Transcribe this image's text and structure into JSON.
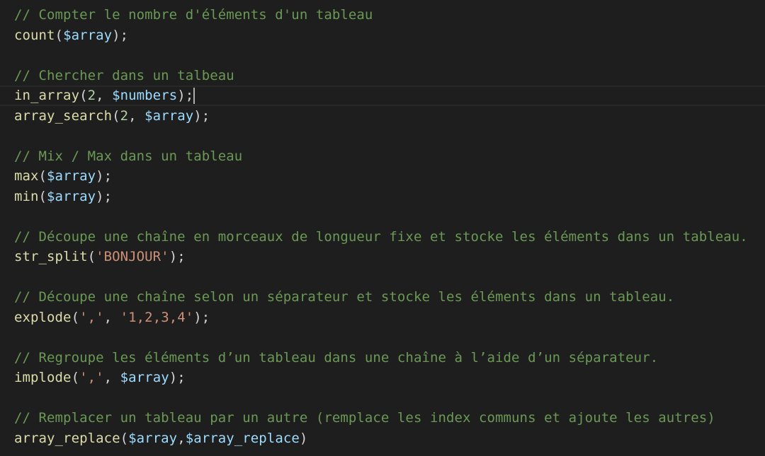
{
  "lines": [
    {
      "type": "comment",
      "text": "// Compter le nombre d'éléments d'un tableau"
    },
    {
      "type": "code",
      "tokens": [
        {
          "k": "fn",
          "t": "count"
        },
        {
          "k": "pun",
          "t": "("
        },
        {
          "k": "var",
          "t": "$array"
        },
        {
          "k": "pun",
          "t": ");"
        }
      ]
    },
    {
      "type": "blank"
    },
    {
      "type": "comment",
      "text": "// Chercher dans un talbeau"
    },
    {
      "type": "code",
      "current": true,
      "tokens": [
        {
          "k": "fn",
          "t": "in_array"
        },
        {
          "k": "pun",
          "t": "("
        },
        {
          "k": "num",
          "t": "2"
        },
        {
          "k": "pun",
          "t": ", "
        },
        {
          "k": "var",
          "t": "$numbers"
        },
        {
          "k": "pun",
          "t": ");"
        }
      ]
    },
    {
      "type": "code",
      "tokens": [
        {
          "k": "fn",
          "t": "array_search"
        },
        {
          "k": "pun",
          "t": "("
        },
        {
          "k": "num",
          "t": "2"
        },
        {
          "k": "pun",
          "t": ", "
        },
        {
          "k": "var",
          "t": "$array"
        },
        {
          "k": "pun",
          "t": ");"
        }
      ]
    },
    {
      "type": "blank"
    },
    {
      "type": "comment",
      "text": "// Mix / Max dans un tableau"
    },
    {
      "type": "code",
      "tokens": [
        {
          "k": "fn",
          "t": "max"
        },
        {
          "k": "pun",
          "t": "("
        },
        {
          "k": "var",
          "t": "$array"
        },
        {
          "k": "pun",
          "t": ");"
        }
      ]
    },
    {
      "type": "code",
      "tokens": [
        {
          "k": "fn",
          "t": "min"
        },
        {
          "k": "pun",
          "t": "("
        },
        {
          "k": "var",
          "t": "$array"
        },
        {
          "k": "pun",
          "t": ");"
        }
      ]
    },
    {
      "type": "blank"
    },
    {
      "type": "comment",
      "text": "// Découpe une chaîne en morceaux de longueur fixe et stocke les éléments dans un tableau."
    },
    {
      "type": "code",
      "tokens": [
        {
          "k": "fn",
          "t": "str_split"
        },
        {
          "k": "pun",
          "t": "("
        },
        {
          "k": "str",
          "t": "'BONJOUR'"
        },
        {
          "k": "pun",
          "t": ");"
        }
      ]
    },
    {
      "type": "blank"
    },
    {
      "type": "comment",
      "text": "// Découpe une chaîne selon un séparateur et stocke les éléments dans un tableau."
    },
    {
      "type": "code",
      "tokens": [
        {
          "k": "fn",
          "t": "explode"
        },
        {
          "k": "pun",
          "t": "("
        },
        {
          "k": "str",
          "t": "','"
        },
        {
          "k": "pun",
          "t": ", "
        },
        {
          "k": "str",
          "t": "'1,2,3,4'"
        },
        {
          "k": "pun",
          "t": ");"
        }
      ]
    },
    {
      "type": "blank"
    },
    {
      "type": "comment",
      "text": "// Regroupe les éléments d’un tableau dans une chaîne à l’aide d’un séparateur."
    },
    {
      "type": "code",
      "tokens": [
        {
          "k": "fn",
          "t": "implode"
        },
        {
          "k": "pun",
          "t": "("
        },
        {
          "k": "str",
          "t": "','"
        },
        {
          "k": "pun",
          "t": ", "
        },
        {
          "k": "var",
          "t": "$array"
        },
        {
          "k": "pun",
          "t": ");"
        }
      ]
    },
    {
      "type": "blank"
    },
    {
      "type": "comment",
      "text": "// Remplacer un tableau par un autre (remplace les index communs et ajoute les autres)"
    },
    {
      "type": "code",
      "tokens": [
        {
          "k": "fn",
          "t": "array_replace"
        },
        {
          "k": "pun",
          "t": "("
        },
        {
          "k": "var",
          "t": "$array"
        },
        {
          "k": "pun",
          "t": ","
        },
        {
          "k": "var",
          "t": "$array_replace"
        },
        {
          "k": "pun",
          "t": ")"
        }
      ]
    }
  ],
  "colors": {
    "background": "#1e1e1e",
    "comment": "#6a9955",
    "function": "#dcdcaa",
    "variable": "#9cdcfe",
    "number": "#b5cea8",
    "string": "#ce9178",
    "punctuation": "#d4d4d4"
  }
}
